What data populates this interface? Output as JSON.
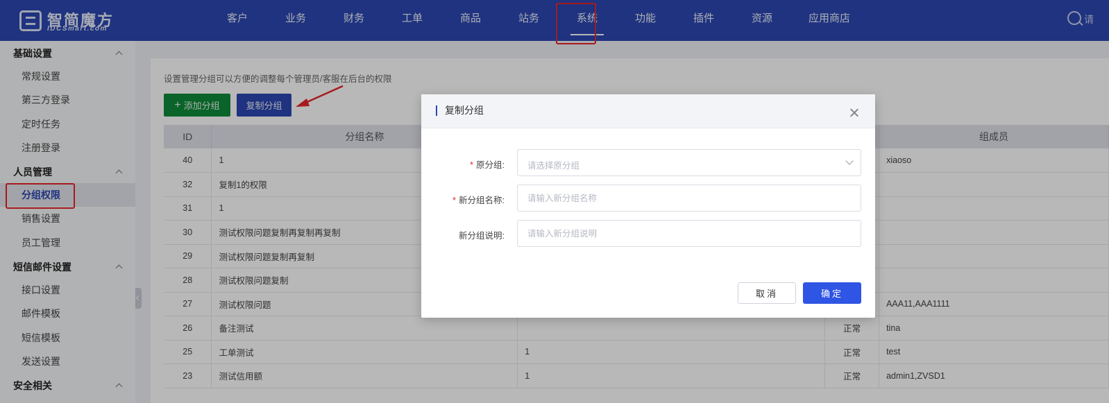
{
  "brand": {
    "title": "智简魔方",
    "subtitle": "IDCSmart.com"
  },
  "nav": {
    "items": [
      "客户",
      "业务",
      "财务",
      "工单",
      "商品",
      "站务",
      "系统",
      "功能",
      "插件",
      "资源",
      "应用商店"
    ],
    "active": "系统",
    "search_partial": "请"
  },
  "sidebar": {
    "groups": [
      {
        "label": "基础设置",
        "items": [
          "常规设置",
          "第三方登录",
          "定时任务",
          "注册登录"
        ]
      },
      {
        "label": "人员管理",
        "items": [
          "分组权限",
          "销售设置",
          "员工管理"
        ]
      },
      {
        "label": "短信邮件设置",
        "items": [
          "接口设置",
          "邮件模板",
          "短信模板",
          "发送设置"
        ]
      },
      {
        "label": "安全相关",
        "items": []
      }
    ],
    "active_item": "分组权限"
  },
  "page": {
    "description": "设置管理分组可以方便的调整每个管理员/客服在后台的权限",
    "add_button": "添加分组",
    "copy_button": "复制分组"
  },
  "table": {
    "headers": [
      "ID",
      "分组名称",
      "",
      "",
      "组成员"
    ],
    "rows": [
      {
        "id": "40",
        "name": "1",
        "desc": "",
        "status": "",
        "members": "xiaoso"
      },
      {
        "id": "32",
        "name": "复制1的权限",
        "desc": "",
        "status": "",
        "members": ""
      },
      {
        "id": "31",
        "name": "1",
        "desc": "",
        "status": "",
        "members": ""
      },
      {
        "id": "30",
        "name": "测试权限问题复制再复制再复制",
        "desc": "",
        "status": "",
        "members": ""
      },
      {
        "id": "29",
        "name": "测试权限问题复制再复制",
        "desc": "",
        "status": "",
        "members": ""
      },
      {
        "id": "28",
        "name": "测试权限问题复制",
        "desc": "",
        "status": "",
        "members": ""
      },
      {
        "id": "27",
        "name": "测试权限问题",
        "desc": "",
        "status": "",
        "members": "AAA11,AAA1111"
      },
      {
        "id": "26",
        "name": "备注测试",
        "desc": "",
        "status": "正常",
        "members": "tina"
      },
      {
        "id": "25",
        "name": "工单测试",
        "desc": "1",
        "status": "正常",
        "members": "test"
      },
      {
        "id": "23",
        "name": "测试信用额",
        "desc": "1",
        "status": "正常",
        "members": "admin1,ZVSD1"
      }
    ]
  },
  "modal": {
    "title": "复制分组",
    "fields": [
      {
        "label": "原分组:",
        "required": true,
        "type": "select",
        "placeholder": "请选择原分组",
        "value": ""
      },
      {
        "label": "新分组名称:",
        "required": true,
        "type": "text",
        "placeholder": "请输入新分组名称",
        "value": ""
      },
      {
        "label": "新分组说明:",
        "required": false,
        "type": "text",
        "placeholder": "请输入新分组说明",
        "value": ""
      }
    ],
    "cancel_label": "取消",
    "ok_label": "确定"
  },
  "colors": {
    "topbar": "#2b47b2",
    "primary": "#2f55e4",
    "success": "#0e8a3a",
    "annotation": "#e8242a"
  }
}
